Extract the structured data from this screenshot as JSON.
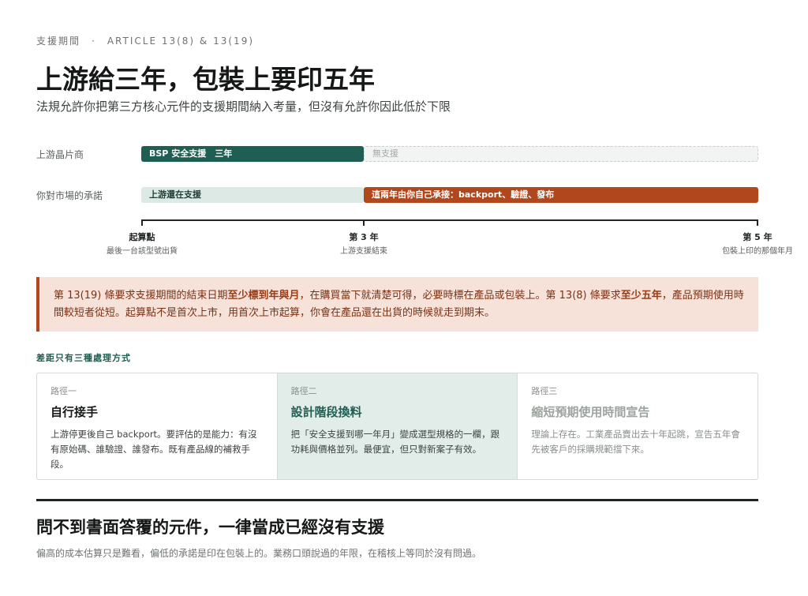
{
  "header": {
    "kicker_left": "支援期間",
    "kicker_sep": "·",
    "kicker_right": "ARTICLE 13(8) & 13(19)",
    "title": "上游給三年，包裝上要印五年",
    "subtitle": "法規允許你把第三方核心元件的支援期間納入考量，但沒有允許你因此低於下限"
  },
  "timeline": {
    "rows": [
      {
        "label": "上游晶片商",
        "segments": [
          {
            "text": "BSP 安全支援　三年",
            "from_year": 0,
            "to_year": 3,
            "style": "solid"
          },
          {
            "text": "無支援",
            "from_year": 3,
            "to_year": 5,
            "style": "dashed"
          }
        ]
      },
      {
        "label": "你對市場的承諾",
        "segments": [
          {
            "text": "上游還在支援",
            "from_year": 0,
            "to_year": 3,
            "style": "light"
          },
          {
            "text": "這兩年由你自己承接：backport、驗證、發布",
            "from_year": 3,
            "to_year": 5,
            "style": "accent"
          }
        ]
      }
    ],
    "ticks": [
      {
        "label": "起算點",
        "sub": "最後一台該型號出貨",
        "year": 0
      },
      {
        "label": "第 3 年",
        "sub": "上游支援結束",
        "year": 3
      },
      {
        "label": "第 5 年",
        "sub": "包裝上印的那個年月",
        "year": 5
      }
    ]
  },
  "callout": {
    "t1": "第 13(19) 條要求支援期間的結束日期",
    "b1": "至少標到年與月",
    "t2": "，在購買當下就清楚可得，必要時標在產品或包裝上。第 13(8) 條要求",
    "b2": "至少五年",
    "t3": "，產品預期使用時間較短者從短。起算點不是首次上市，用首次上市起算，你會在產品還在出貨的時候就走到期末。"
  },
  "paths": {
    "heading": "差距只有三種處理方式",
    "items": [
      {
        "tag": "路徑一",
        "title": "自行接手",
        "body": "上游停更後自己 backport。要評估的是能力：有沒有原始碼、誰驗證、誰發布。既有產品線的補救手段。"
      },
      {
        "tag": "路徑二",
        "title": "設計階段換料",
        "body": "把「安全支援到哪一年月」變成選型規格的一欄，跟功耗與價格並列。最便宜，但只對新案子有效。"
      },
      {
        "tag": "路徑三",
        "title": "縮短預期使用時間宣告",
        "body": "理論上存在。工業產品賣出去十年起跳，宣告五年會先被客戶的採購規範擋下來。"
      }
    ]
  },
  "footer": {
    "title": "問不到書面答覆的元件，一律當成已經沒有支援",
    "subtitle": "偏高的成本估算只是難看，偏低的承諾是印在包裝上的。業務口頭說過的年限，在稽核上等同於沒有問過。"
  },
  "colors": {
    "green": "#1f5e52",
    "rust": "#b0471d",
    "callout_bg": "#f7e2d9",
    "path_highlight": "#e2ede9"
  }
}
